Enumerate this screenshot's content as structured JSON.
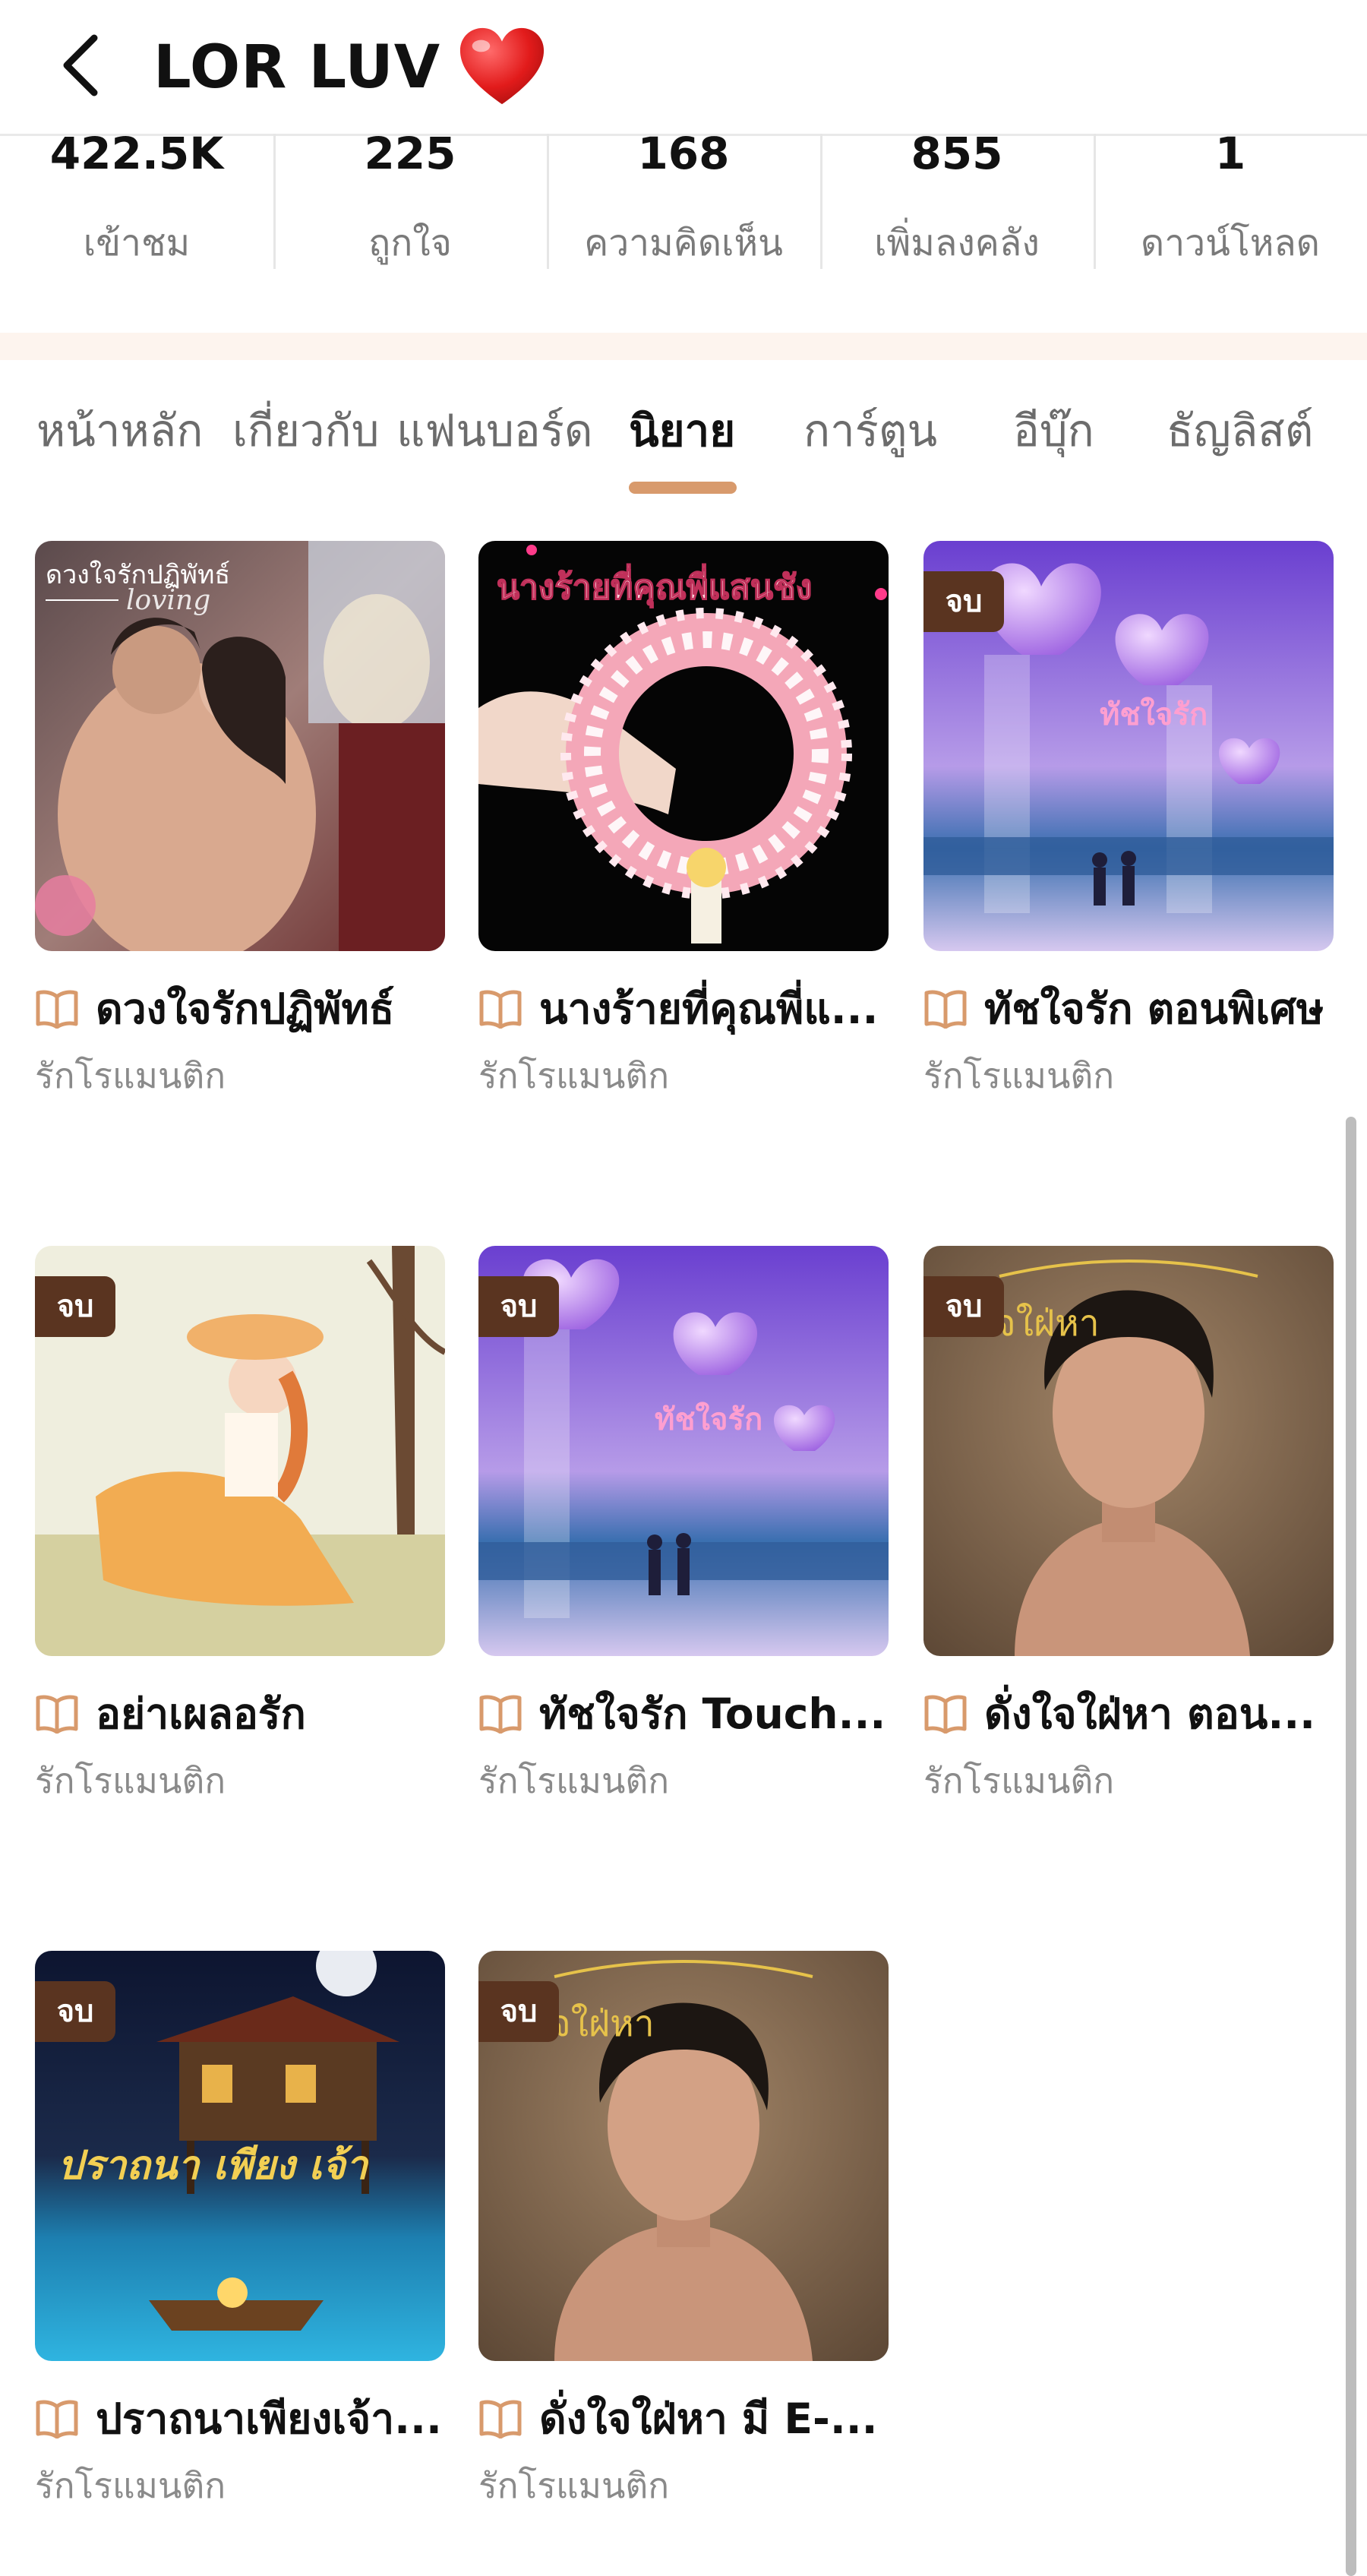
{
  "header": {
    "title": "LOR LUV",
    "title_emoji": "❤️"
  },
  "stats": [
    {
      "value": "422.5K",
      "label": "เข้าชม"
    },
    {
      "value": "225",
      "label": "ถูกใจ"
    },
    {
      "value": "168",
      "label": "ความคิดเห็น"
    },
    {
      "value": "855",
      "label": "เพิ่มลงคลัง"
    },
    {
      "value": "1",
      "label": "ดาวน์โหลด"
    }
  ],
  "tabs": [
    {
      "label": "หน้าหลัก",
      "active": false
    },
    {
      "label": "เกี่ยวกับ",
      "active": false
    },
    {
      "label": "แฟนบอร์ด",
      "active": false
    },
    {
      "label": "นิยาย",
      "active": true
    },
    {
      "label": "การ์ตูน",
      "active": false
    },
    {
      "label": "อีบุ๊ก",
      "active": false
    },
    {
      "label": "ธัญลิสต์",
      "active": false
    }
  ],
  "novels": [
    {
      "title": "ดวงใจรักปฏิพัทธ์",
      "genre": "รักโรแมนติก",
      "badge": "",
      "cover_text": "ดวงใจรักปฏิพัทธ์",
      "cover_subtext": "loving"
    },
    {
      "title": "นางร้ายที่คุณพี่แ...",
      "genre": "รักโรแมนติก",
      "badge": "",
      "cover_text": "นางร้ายที่คุณพี่แสนชัง",
      "cover_subtext": ""
    },
    {
      "title": "ทัชใจรัก ตอนพิเศษ",
      "genre": "รักโรแมนติก",
      "badge": "จบ",
      "cover_text": "ทัชใจรัก",
      "cover_subtext": ""
    },
    {
      "title": "อย่าเผลอรัก",
      "genre": "รักโรแมนติก",
      "badge": "จบ",
      "cover_text": "",
      "cover_subtext": ""
    },
    {
      "title": "ทัชใจรัก Touch...",
      "genre": "รักโรแมนติก",
      "badge": "จบ",
      "cover_text": "ทัชใจรัก",
      "cover_subtext": ""
    },
    {
      "title": "ดั่งใจใฝ่หา ตอน...",
      "genre": "รักโรแมนติก",
      "badge": "จบ",
      "cover_text": "ใจใฝ่หา",
      "cover_subtext": ""
    },
    {
      "title": "ปราถนาเพียงเจ้า...",
      "genre": "รักโรแมนติก",
      "badge": "จบ",
      "cover_text": "ปราถนา เพียง เจ้า",
      "cover_subtext": ""
    },
    {
      "title": "ดั่งใจใฝ่หา มี E-...",
      "genre": "รักโรแมนติก",
      "badge": "จบ",
      "cover_text": "ใจใฝ่หา",
      "cover_subtext": ""
    }
  ],
  "colors": {
    "accent": "#d89a6c",
    "badge_bg": "#5a3420",
    "band": "#fdf4ee"
  }
}
